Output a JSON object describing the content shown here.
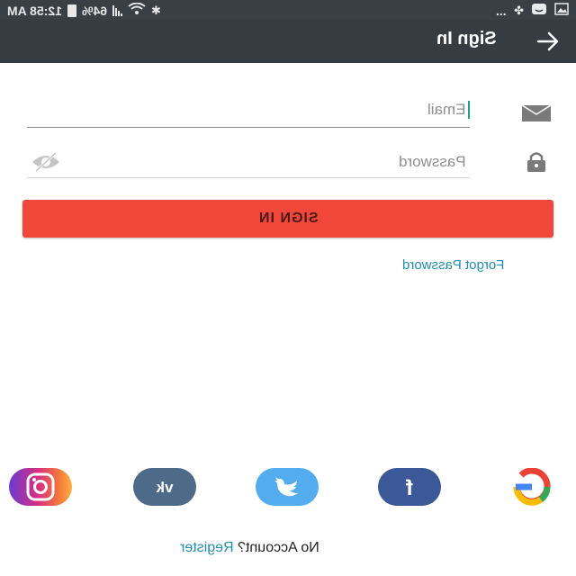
{
  "status_bar": {
    "time": "12:58 AM",
    "battery": "64%",
    "more": "..."
  },
  "app_bar": {
    "title": "Sign In"
  },
  "form": {
    "email_placeholder": "Email",
    "password_placeholder": "Password",
    "signin_label": "SIGN IN",
    "forgot_label": "Forgot Password"
  },
  "social": [
    "instagram-icon",
    "vk-icon",
    "twitter-icon",
    "facebook-icon",
    "google-icon"
  ],
  "footer": {
    "no_account": "No Account?",
    "register": "Register"
  },
  "colors": {
    "app_bar": "#373c43",
    "primary_button": "#f0473a",
    "link": "#1f8fb0"
  }
}
